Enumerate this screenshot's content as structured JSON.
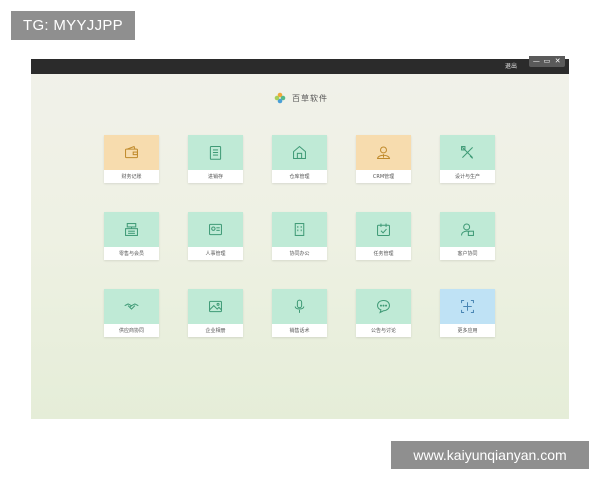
{
  "overlay": {
    "tg_handle": "TG: MYYJJPP",
    "site_url": "www.kaiyunqianyan.com"
  },
  "window": {
    "logout_label": "退出",
    "controls": [
      "—",
      "▭",
      "✕"
    ]
  },
  "brand": {
    "name": "百草软件",
    "colors": [
      "#f0a83a",
      "#57b98a",
      "#4a9fd6",
      "#a6cf5a"
    ]
  },
  "colors": {
    "tile_green": "#bfead6",
    "tile_orange": "#f7dcae",
    "tile_blue": "#bfe2f5"
  },
  "tiles": [
    {
      "label": "财务记账",
      "icon": "wallet-icon",
      "accent": "orange"
    },
    {
      "label": "进销存",
      "icon": "document-list-icon",
      "accent": "green"
    },
    {
      "label": "仓库管理",
      "icon": "warehouse-icon",
      "accent": "green"
    },
    {
      "label": "CRM管理",
      "icon": "user-crm-icon",
      "accent": "orange"
    },
    {
      "label": "设计与生产",
      "icon": "design-tools-icon",
      "accent": "green"
    },
    {
      "label": "零售与会员",
      "icon": "cash-register-icon",
      "accent": "green"
    },
    {
      "label": "人事管理",
      "icon": "personnel-card-icon",
      "accent": "green"
    },
    {
      "label": "协同办公",
      "icon": "office-building-icon",
      "accent": "green"
    },
    {
      "label": "任务管理",
      "icon": "calendar-check-icon",
      "accent": "green"
    },
    {
      "label": "客户协同",
      "icon": "customer-icon",
      "accent": "green"
    },
    {
      "label": "供应商协同",
      "icon": "handshake-icon",
      "accent": "green"
    },
    {
      "label": "企业相册",
      "icon": "photo-icon",
      "accent": "green"
    },
    {
      "label": "销售话术",
      "icon": "microphone-icon",
      "accent": "green"
    },
    {
      "label": "公告与讨论",
      "icon": "chat-bubble-icon",
      "accent": "green"
    },
    {
      "label": "更多应用",
      "icon": "add-app-icon",
      "accent": "blue"
    }
  ]
}
